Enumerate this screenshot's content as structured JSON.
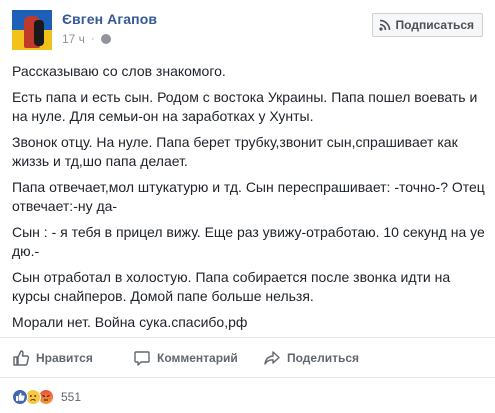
{
  "post": {
    "author": "Євген Агапов",
    "time": "17 ч",
    "subscribe_label": "Подписаться",
    "paragraphs": [
      "Рассказываю со слов знакомого.",
      "Есть папа и есть сын. Родом с востока Украины. Папа пошел воевать и на нуле. Для семьи-он на заработках у Хунты.",
      "Звонок отцу. На нуле. Папа берет трубку,звонит сын,спрашивает как жиззь и тд,шо папа делает.",
      "Папа отвечает,мол штукатурю и тд. Сын переспрашивает: -точно-? Отец отвечает:-ну да-",
      "Сын : - я тебя в прицел вижу. Еще раз увижу-отработаю. 10 секунд на уе дю.-",
      "Сын отработал в холостую. Папа собирается после звонка идти на курсы снайперов. Домой папе больше нельзя.",
      "Морали нет. Война сука.спасибо,рф"
    ]
  },
  "actions": {
    "like_label": "Нравится",
    "comment_label": "Комментарий",
    "share_label": "Поделиться"
  },
  "reactions": {
    "types": [
      "like-icon",
      "sad-icon",
      "angry-icon"
    ],
    "count": "551"
  },
  "colors": {
    "author_link": "#365899",
    "meta": "#90949c",
    "action_text": "#616770",
    "like_reaction": "#4267b2"
  }
}
